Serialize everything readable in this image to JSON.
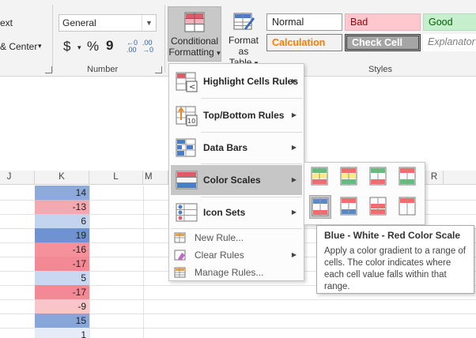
{
  "ribbon": {
    "alignment_partial": {
      "line1": "ext",
      "line2": "& Center",
      "caret": "▾"
    },
    "number": {
      "format_value": "General",
      "group_label": "Number",
      "currency_symbol": "$",
      "percent_symbol": "%",
      "comma_symbol": "9"
    },
    "conditional_formatting": {
      "line1": "Conditional",
      "line2": "Formatting",
      "caret": "▾"
    },
    "format_as_table": {
      "line1": "Format as",
      "line2": "Table",
      "caret": "▾"
    },
    "styles": {
      "group_label": "Styles",
      "items": [
        {
          "label": "Normal",
          "bg": "#ffffff",
          "fg": "#000000"
        },
        {
          "label": "Bad",
          "bg": "#ffc7ce",
          "fg": "#9c0006"
        },
        {
          "label": "Good",
          "bg": "#c6efce",
          "fg": "#006100"
        },
        {
          "label": "Calculation",
          "bg": "#f2f2f2",
          "fg": "#fa7d00"
        },
        {
          "label": "Check Cell",
          "bg": "#a5a5a5",
          "fg": "#ffffff"
        },
        {
          "label": "Explanator",
          "bg": "#ffffff",
          "fg": "#7f7f7f"
        }
      ]
    }
  },
  "grid": {
    "columns": [
      "J",
      "K",
      "L",
      "M",
      "R"
    ],
    "k_values": [
      {
        "value": "14",
        "color": "#8eaadb"
      },
      {
        "value": "-13",
        "color": "#f4a8b0"
      },
      {
        "value": "6",
        "color": "#c3d4ee"
      },
      {
        "value": "19",
        "color": "#6f93d0"
      },
      {
        "value": "-16",
        "color": "#f4919b"
      },
      {
        "value": "-17",
        "color": "#f38994"
      },
      {
        "value": "5",
        "color": "#c9d8f0"
      },
      {
        "value": "-17",
        "color": "#f38994"
      },
      {
        "value": "-9",
        "color": "#f8c5cb"
      },
      {
        "value": "15",
        "color": "#88a6da"
      },
      {
        "value": "1",
        "color": "#e6ecf7"
      }
    ]
  },
  "menu": {
    "items": [
      {
        "label": "Highlight Cells Rules"
      },
      {
        "label": "Top/Bottom Rules"
      },
      {
        "label": "Data Bars"
      },
      {
        "label": "Color Scales"
      },
      {
        "label": "Icon Sets"
      }
    ],
    "small_items": [
      {
        "label": "New Rule..."
      },
      {
        "label": "Clear Rules"
      },
      {
        "label": "Manage Rules..."
      }
    ],
    "arrow": "▶"
  },
  "tooltip": {
    "title": "Blue - White - Red Color Scale",
    "body": "Apply a color gradient to a range of cells. The color indicates where each cell value falls within that range."
  },
  "colors": {
    "menu_hover": "#c6c6c6",
    "ribbon_bg": "#f3f3f3"
  }
}
